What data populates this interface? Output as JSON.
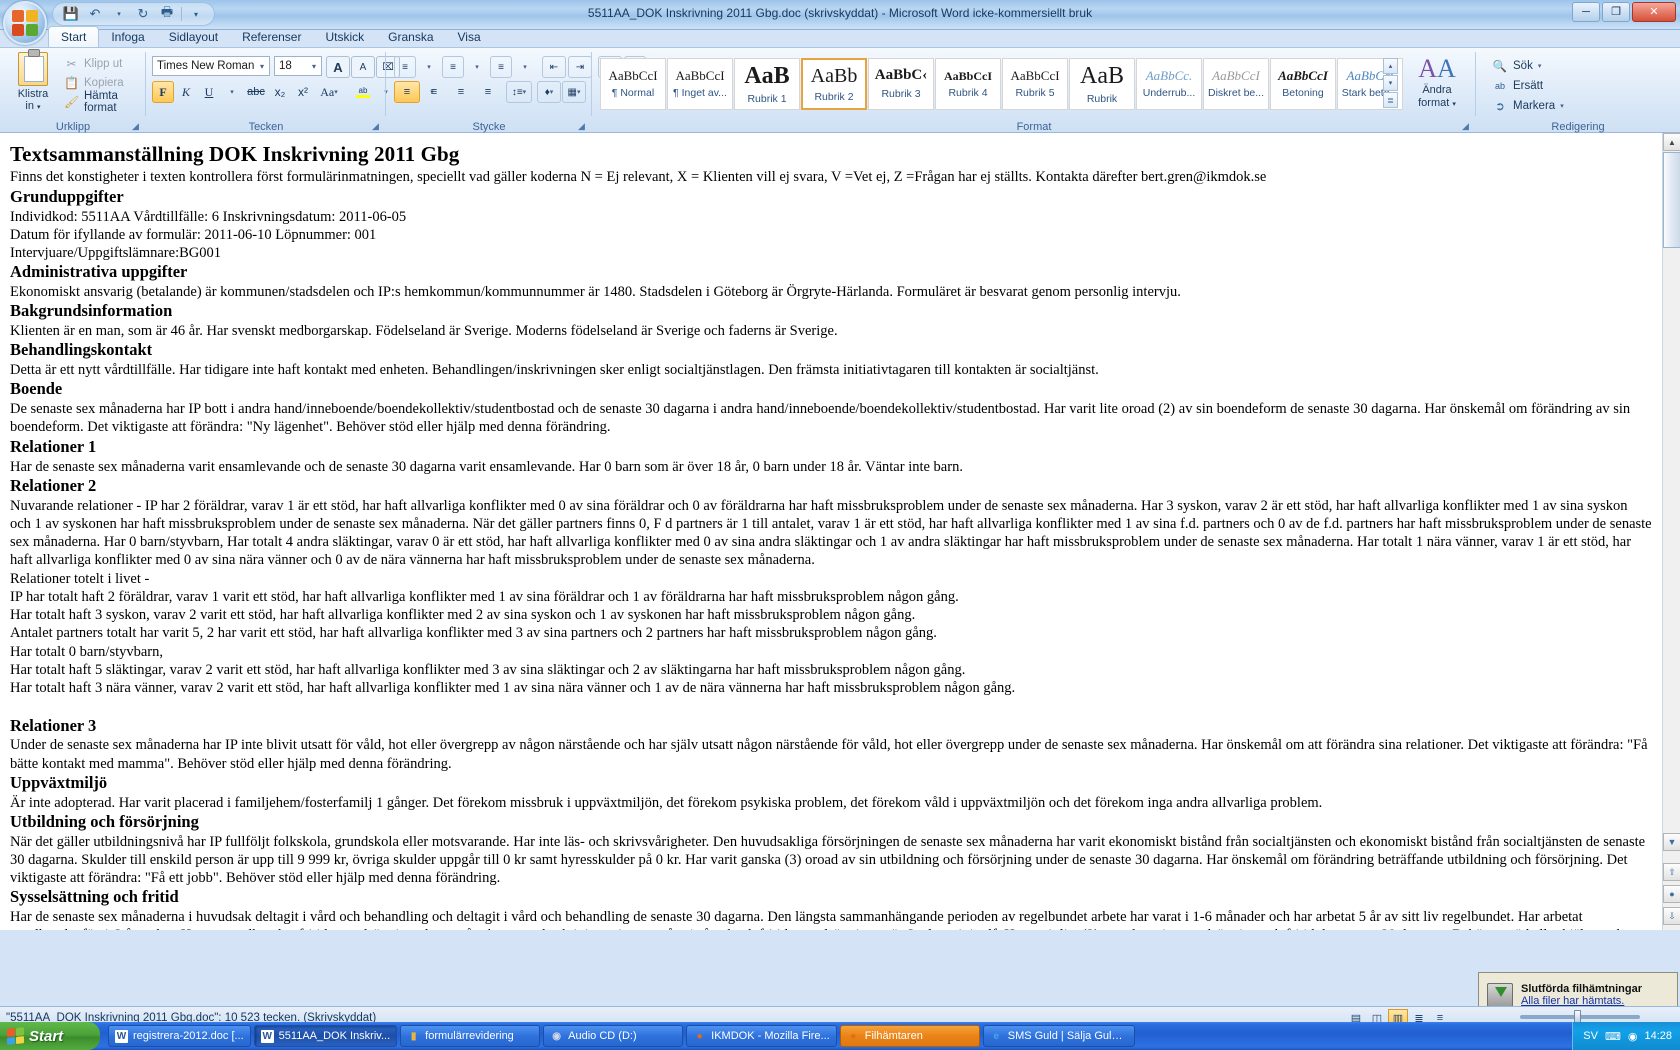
{
  "window": {
    "title": "5511AA_DOK Inskrivning 2011 Gbg.doc (skrivskyddat) - Microsoft Word icke-kommersiellt bruk",
    "minimize": "─",
    "maximize": "❐",
    "close": "✕"
  },
  "quick_access": {
    "save": "💾",
    "undo": "↶",
    "undo_caret": "▾",
    "redo": "↻",
    "print_preview": "🖶",
    "customize": "➕"
  },
  "tabs": [
    {
      "label": "Start",
      "active": true
    },
    {
      "label": "Infoga",
      "active": false
    },
    {
      "label": "Sidlayout",
      "active": false
    },
    {
      "label": "Referenser",
      "active": false
    },
    {
      "label": "Utskick",
      "active": false
    },
    {
      "label": "Granska",
      "active": false
    },
    {
      "label": "Visa",
      "active": false
    }
  ],
  "ribbon": {
    "clipboard": {
      "title": "Urklipp",
      "paste_label": "Klistra\nin",
      "cut": "Klipp ut",
      "copy": "Kopiera",
      "format_painter": "Hämta format"
    },
    "font": {
      "title": "Tecken",
      "font_name": "Times New Roman",
      "font_size": "18",
      "grow": "A",
      "shrink": "A",
      "clear_format": "A",
      "bold": "F",
      "italic": "K",
      "underline": "U",
      "strikethrough": "abc",
      "subscript": "x₂",
      "superscript": "x²",
      "change_case": "Aa",
      "highlight": "ab",
      "font_color": "A"
    },
    "paragraph": {
      "title": "Stycke",
      "bullets": "•≡",
      "numbering": "1≡",
      "multilevel": "≡",
      "decrease_indent": "←≡",
      "increase_indent": "≡→",
      "sort": "A↓",
      "show_marks": "¶",
      "align_left": "≡",
      "align_center": "≡",
      "align_right": "≡",
      "justify": "≡",
      "line_spacing": "↕≡",
      "shading": "■",
      "borders": "▦"
    },
    "styles": {
      "title": "Format",
      "items": [
        {
          "preview": "AaBbCcI",
          "name": "¶ Normal",
          "selected": false,
          "style": "serif-small"
        },
        {
          "preview": "AaBbCcI",
          "name": "¶ Inget av...",
          "selected": false,
          "style": "serif-small"
        },
        {
          "preview": "AaB",
          "name": "Rubrik 1",
          "selected": false,
          "style": "serif-huge-bold"
        },
        {
          "preview": "AaBb",
          "name": "Rubrik 2",
          "selected": true,
          "style": "serif-big"
        },
        {
          "preview": "AaBbC‹",
          "name": "Rubrik 3",
          "selected": false,
          "style": "serif-bold"
        },
        {
          "preview": "AaBbCcI",
          "name": "Rubrik 4",
          "selected": false,
          "style": "serif-bold-sm"
        },
        {
          "preview": "AaBbCcI",
          "name": "Rubrik 5",
          "selected": false,
          "style": "serif-small"
        },
        {
          "preview": "AaB",
          "name": "Rubrik",
          "selected": false,
          "style": "serif-huge"
        },
        {
          "preview": "AaBbCc.",
          "name": "Underrub...",
          "selected": false,
          "style": "serif-italic-blue"
        },
        {
          "preview": "AaBbCcI",
          "name": "Diskret be...",
          "selected": false,
          "style": "serif-italic-gray"
        },
        {
          "preview": "AaBbCcI",
          "name": "Betoning",
          "selected": false,
          "style": "serif-italic-bold"
        },
        {
          "preview": "AaBbCci",
          "name": "Stark beto...",
          "selected": false,
          "style": "serif-italic-blue2"
        }
      ],
      "scroll_up": "▴",
      "scroll_down": "▾",
      "more": "≣",
      "change_styles": "Ändra\nformat"
    },
    "editing": {
      "title": "Redigering",
      "find": "Sök",
      "replace": "Ersätt",
      "select": "Markera"
    }
  },
  "document": {
    "title": "Textsammanställning DOK Inskrivning 2011 Gbg",
    "intro": "Finns det konstigheter i texten kontrollera först formulärinmatningen, speciellt vad gäller koderna N = Ej relevant, X = Klienten vill ej svara, V =Vet ej, Z =Frågan har ej ställts. Kontakta därefter bert.gren@ikmdok.se",
    "sections": [
      {
        "heading": "Grunduppgifter",
        "paragraphs": [
          "Individkod: 5511AA Vårdtillfälle: 6 Inskrivningsdatum: 2011-06-05",
          "Datum för ifyllande av formulär: 2011-06-10 Löpnummer: 001",
          "Intervjuare/Uppgiftslämnare:BG001"
        ]
      },
      {
        "heading": "Administrativa uppgifter",
        "paragraphs": [
          "Ekonomiskt ansvarig (betalande) är kommunen/stadsdelen och IP:s hemkommun/kommunnummer är 1480. Stadsdelen i Göteborg är Örgryte-Härlanda. Formuläret är besvarat genom personlig intervju."
        ]
      },
      {
        "heading": "Bakgrundsinformation",
        "paragraphs": [
          "Klienten är en man, som är 46 år. Har svenskt medborgarskap. Födelseland är Sverige. Moderns födelseland är Sverige och faderns är Sverige."
        ]
      },
      {
        "heading": "Behandlingskontakt",
        "paragraphs": [
          "Detta är ett nytt vårdtillfälle. Har tidigare inte haft kontakt med enheten. Behandlingen/inskrivningen sker enligt socialtjänstlagen. Den främsta initiativtagaren till kontakten är socialtjänst."
        ]
      },
      {
        "heading": "Boende",
        "paragraphs": [
          "De senaste sex månaderna har IP bott i andra hand/inneboende/boendekollektiv/studentbostad och de senaste 30 dagarna i andra hand/inneboende/boendekollektiv/studentbostad. Har varit lite oroad (2) av sin boendeform de senaste 30 dagarna. Har önskemål om förändring av sin boendeform. Det viktigaste att förändra: \"Ny lägenhet\". Behöver stöd eller hjälp med denna förändring."
        ]
      },
      {
        "heading": "Relationer 1",
        "paragraphs": [
          "Har de senaste sex månaderna varit ensamlevande och de senaste 30 dagarna varit ensamlevande. Har 0 barn som är över 18 år, 0 barn under 18 år. Väntar inte barn."
        ]
      },
      {
        "heading": "Relationer 2",
        "paragraphs": [
          "Nuvarande relationer - IP har 2 föräldrar, varav 1 är ett stöd, har haft allvarliga konflikter med 0 av sina föräldrar och 0 av föräldrarna har haft missbruksproblem under de senaste sex månaderna. Har 3 syskon, varav 2 är ett stöd, har haft allvarliga konflikter med 1 av sina syskon och 1 av syskonen har haft missbruksproblem under de senaste sex månaderna. När det gäller partners finns 0, F d partners är 1 till antalet, varav 1 är ett stöd, har haft allvarliga konflikter med 1 av sina f.d. partners och 0 av de f.d. partners har haft missbruksproblem under de senaste sex månaderna. Har 0 barn/styvbarn, Har totalt 4 andra släktingar, varav 0 är ett stöd, har haft allvarliga konflikter med 0 av sina andra släktingar och 1 av andra släktingar har haft missbruksproblem under de senaste sex månaderna. Har totalt 1 nära vänner, varav 1 är ett stöd, har haft allvarliga konflikter med 0 av sina nära vänner och 0 av de nära vännerna har haft missbruksproblem under de senaste sex månaderna.",
          "Relationer totelt i livet -",
          "IP har totalt haft 2 föräldrar, varav 1 varit ett stöd, har haft allvarliga konflikter med 1 av sina föräldrar  och 1 av föräldrarna har haft missbruksproblem någon gång.",
          "Har totalt haft 3 syskon,  varav 2 varit ett stöd, har haft allvarliga konflikter med 2 av sina syskon och 1 av syskonen har haft missbruksproblem någon gång.",
          "Antalet partners totalt har varit 5, 2 har varit ett stöd, har haft allvarliga konflikter med 3 av sina partners och 2 partners har haft missbruksproblem någon gång.",
          "Har totalt 0 barn/styvbarn,",
          "Har totalt haft 5 släktingar, varav 2 varit ett stöd, har haft allvarliga konflikter med 3 av sina släktingar  och 2 av släktingarna har haft missbruksproblem någon gång.",
          "Har totalt haft 3 nära vänner, varav 2 varit ett stöd, har haft allvarliga konflikter med 1 av sina nära vänner och 1 av de nära vännerna har haft missbruksproblem någon gång."
        ]
      },
      {
        "heading": "Relationer 3",
        "paragraphs": [
          "Under de senaste sex månaderna har IP inte blivit utsatt för våld, hot eller övergrepp av någon närstående och har själv utsatt någon närstående för våld, hot eller övergrepp under de senaste sex månaderna. Har önskemål om att förändra sina relationer. Det viktigaste att förändra: \"Få bätte kontakt med mamma\". Behöver stöd eller hjälp med denna förändring."
        ]
      },
      {
        "heading": "Uppväxtmiljö",
        "paragraphs": [
          "Är inte adopterad. Har varit placerad i familjehem/fosterfamilj 1 gånger. Det förekom missbruk i uppväxtmiljön, det förekom psykiska problem, det förekom våld i uppväxtmiljön och det förekom inga andra allvarliga problem."
        ]
      },
      {
        "heading": "Utbildning och försörjning",
        "paragraphs": [
          "När det gäller utbildningsnivå har IP fullföljt folkskola, grundskola eller motsvarande. Har inte läs- och skrivsvårigheter. Den huvudsakliga försörjningen de senaste sex månaderna har varit ekonomiskt bistånd från socialtjänsten och ekonomiskt bistånd från socialtjänsten de senaste 30 dagarna.  Skulder till enskild person är upp till 9 999 kr, övriga skulder uppgår till 0 kr samt hyresskulder på 0 kr. Har varit ganska (3) oroad av sin utbildning och försörjning under de senaste 30 dagarna. Har önskemål om förändring beträffande utbildning och försörjning. Det viktigaste att förändra: \"Få ett jobb\". Behöver stöd eller hjälp med denna förändring."
        ]
      },
      {
        "heading": "Sysselsättning och fritid",
        "paragraphs": [
          "Har de senaste sex månaderna i huvudsak deltagit i vård och behandling och deltagit i vård och behandling de senaste 30 dagarna. Den längsta sammanhängande perioden av regelbundet arbete har varat i 1-6 månader och har arbetat 5 år av sitt liv regelbundet. Har arbetat regelbundet för 1-2 år sedan. Har en regelbunden fritidssysselsättning, dvs. en återkommande aktivitet minst en gång/månad och fritidssysselsättningen är Spelar minigolf. Har varit lite (2) oroad av sin sysselsättning och fritid de senaste 30 dagarna. Behöver stöd eller hjälp med denna förändring. Har önskemål om förändring beträffande sysselsättning och fritid. Det viktigaste att förändra: \"Bli mer aktiv\"."
        ]
      }
    ]
  },
  "statusbar": {
    "text": "\"5511AA_DOK Inskrivning 2011 Gbg.doc\": 10 523 tecken.  (Skrivskyddat)",
    "views": [
      "▤",
      "◫",
      "▥",
      "≣",
      "≡"
    ],
    "active_view_index": 2,
    "zoom": "",
    "zoom_out": "−",
    "zoom_in": "+"
  },
  "download_popup": {
    "title": "Slutförda filhämtningar",
    "link": "Alla filer har hämtats."
  },
  "taskbar": {
    "start": "Start",
    "items": [
      {
        "label": "registrera-2012.doc [...",
        "icon": "word-icon",
        "state": "normal"
      },
      {
        "label": "5511AA_DOK Inskriv...",
        "icon": "word-icon",
        "state": "active"
      },
      {
        "label": "formulärrevidering",
        "icon": "folder-icon",
        "state": "normal"
      },
      {
        "label": "Audio CD (D:)",
        "icon": "cd-icon",
        "state": "normal"
      },
      {
        "label": "IKMDOK - Mozilla Fire...",
        "icon": "firefox-icon",
        "state": "normal"
      },
      {
        "label": "Filhämtaren",
        "icon": "firefox-icon",
        "state": "firefox-active"
      },
      {
        "label": "SMS Guld | Sälja Guld ...",
        "icon": "ie-icon",
        "state": "normal"
      }
    ],
    "tray": {
      "language": "SV",
      "keyboard_icon": "⌨",
      "network_icon": "◉",
      "clock": "14:28"
    }
  },
  "colors": {
    "accent": "#2e5584",
    "selected_style_border": "#e8a33d",
    "taskbar_blue": "#2767cf",
    "firefox_orange": "#ea8317",
    "start_green": "#4aa239"
  }
}
